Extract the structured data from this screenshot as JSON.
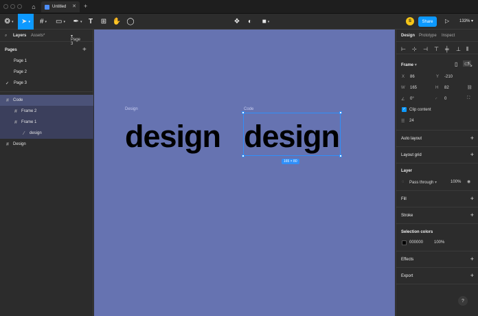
{
  "tab": {
    "title": "Untitled"
  },
  "toolbar": {
    "avatar_initial": "S",
    "share_label": "Share",
    "zoom": "133%"
  },
  "left_panel": {
    "tabs": [
      "Layers",
      "Assets*"
    ],
    "page_selector": "Page 3",
    "pages_title": "Pages",
    "pages": [
      "Page 1",
      "Page 2",
      "Page 3"
    ],
    "current_page_mark": "✓",
    "layers": [
      "Code",
      "Frame 2",
      "Frame 1",
      "design",
      "Design"
    ]
  },
  "canvas": {
    "frame_labels": [
      "Design",
      "Code"
    ],
    "word1": "design",
    "word2": "design",
    "dimension_badge": "165 × 80",
    "background": "#6673b1"
  },
  "right_panel": {
    "tabs": [
      "Design",
      "Prototype",
      "Inspect"
    ],
    "frame_title": "Frame",
    "x_label": "X",
    "x_value": "86",
    "y_label": "Y",
    "y_value": "-210",
    "w_label": "W",
    "w_value": "165",
    "h_label": "H",
    "h_value": "82",
    "rotation": "0°",
    "radius": "0",
    "clip_label": "Clip content",
    "spacing_value": "24",
    "auto_layout": "Auto layout",
    "layout_grid": "Layout grid",
    "layer_title": "Layer",
    "blend_mode": "Pass through",
    "opacity": "100%",
    "fill": "Fill",
    "stroke": "Stroke",
    "selection_colors": "Selection colors",
    "sel_color_hex": "000000",
    "sel_color_opacity": "100%",
    "effects": "Effects",
    "export": "Export"
  }
}
